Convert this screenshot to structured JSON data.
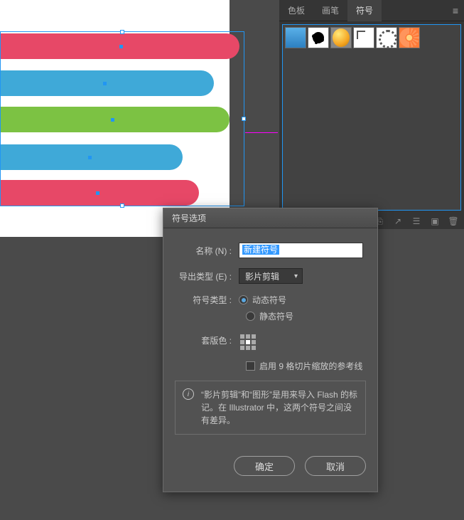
{
  "canvas": {
    "shapes": [
      "red",
      "blue",
      "green",
      "blue",
      "red"
    ]
  },
  "panel": {
    "tabs": {
      "swatches": "色板",
      "brushes": "画笔",
      "symbols": "符号"
    },
    "symbols": [
      {
        "name": "gradient-bar"
      },
      {
        "name": "ink-splat"
      },
      {
        "name": "orange-ball"
      },
      {
        "name": "corner-mark"
      },
      {
        "name": "gear-ring"
      },
      {
        "name": "gerbera-flower"
      }
    ]
  },
  "dialog": {
    "title": "符号选项",
    "name_label": "名称 (N) :",
    "name_value": "新建符号",
    "export_label": "导出类型 (E) :",
    "export_value": "影片剪辑",
    "type_label": "符号类型 :",
    "type_dynamic": "动态符号",
    "type_static": "静态符号",
    "registration_label": "套版色 :",
    "enable_slice": "启用 9 格切片缩放的参考线",
    "info_text": "“影片剪辑”和“图形”是用来导入 Flash 的标记。在 Illustrator 中，这两个符号之间没有差异。",
    "ok": "确定",
    "cancel": "取消"
  }
}
